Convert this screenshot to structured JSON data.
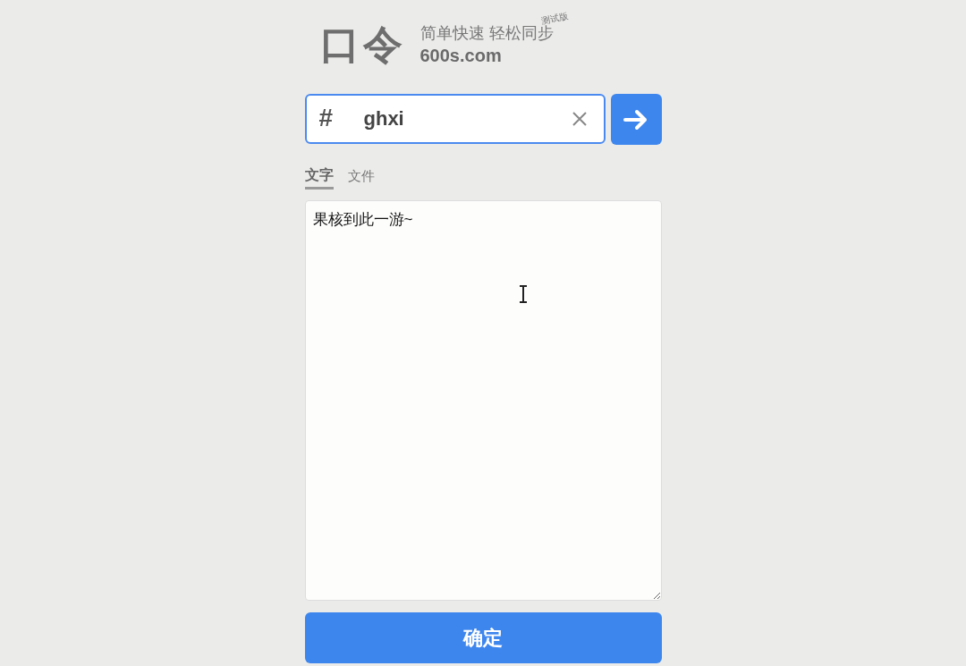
{
  "logo": {
    "mark": "口令",
    "slogan": "简单快速 轻松同步",
    "badge": "测试版",
    "domain": "600s.com"
  },
  "code_field": {
    "prefix": "#",
    "value": "ghxi"
  },
  "tabs": [
    {
      "label": "文字",
      "selected": true
    },
    {
      "label": "文件",
      "selected": false
    }
  ],
  "text_area": {
    "value": "果核到此一游~"
  },
  "confirm_button": "确定"
}
